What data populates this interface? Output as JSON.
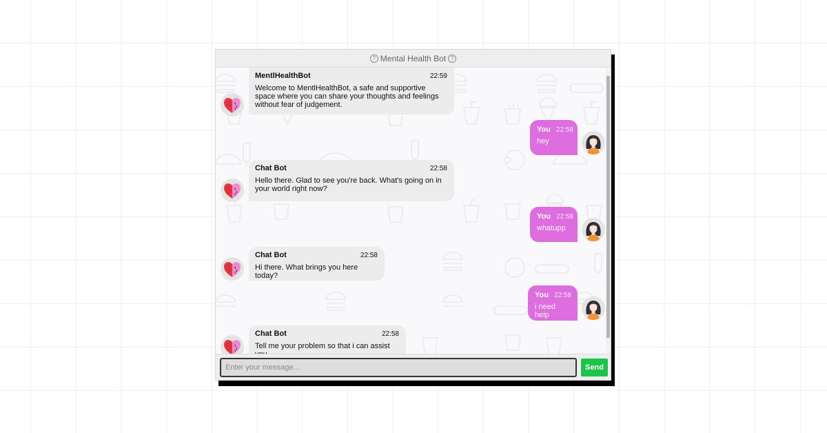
{
  "header": {
    "title": "Mental Health Bot",
    "left_icon": "help-circle-icon",
    "right_icon": "help-circle-icon"
  },
  "colors": {
    "user_bubble": "#de6ee0",
    "bot_bubble": "#ececec",
    "send_button": "#1cc44a"
  },
  "messages": [
    {
      "sender": "bot",
      "name": "MentlHealthBot",
      "time": "22:59",
      "text": "Welcome to MentlHealthBot, a safe and supportive space where you can share your thoughts and feelings without fear of judgement.",
      "avatar": "heart-brain-icon"
    },
    {
      "sender": "user",
      "name": "You",
      "time": "22:58",
      "text": "hey",
      "avatar": "user-woman-icon"
    },
    {
      "sender": "bot",
      "name": "Chat Bot",
      "time": "22:58",
      "text": "Hello there. Glad to see you're back. What's going on in your world right now?",
      "avatar": "heart-brain-icon"
    },
    {
      "sender": "user",
      "name": "You",
      "time": "22:58",
      "text": "whatupp",
      "avatar": "user-woman-icon"
    },
    {
      "sender": "bot",
      "name": "Chat Bot",
      "time": "22:58",
      "text": "Hi there. What brings you here today?",
      "avatar": "heart-brain-icon"
    },
    {
      "sender": "user",
      "name": "You",
      "time": "22:58",
      "text": "i need help",
      "avatar": "user-woman-icon"
    },
    {
      "sender": "bot",
      "name": "Chat Bot",
      "time": "22:58",
      "text": "Tell me your problem so that i can assist you",
      "avatar": "heart-brain-icon"
    }
  ],
  "composer": {
    "placeholder": "Enter your message...",
    "value": "",
    "send_label": "Send"
  }
}
